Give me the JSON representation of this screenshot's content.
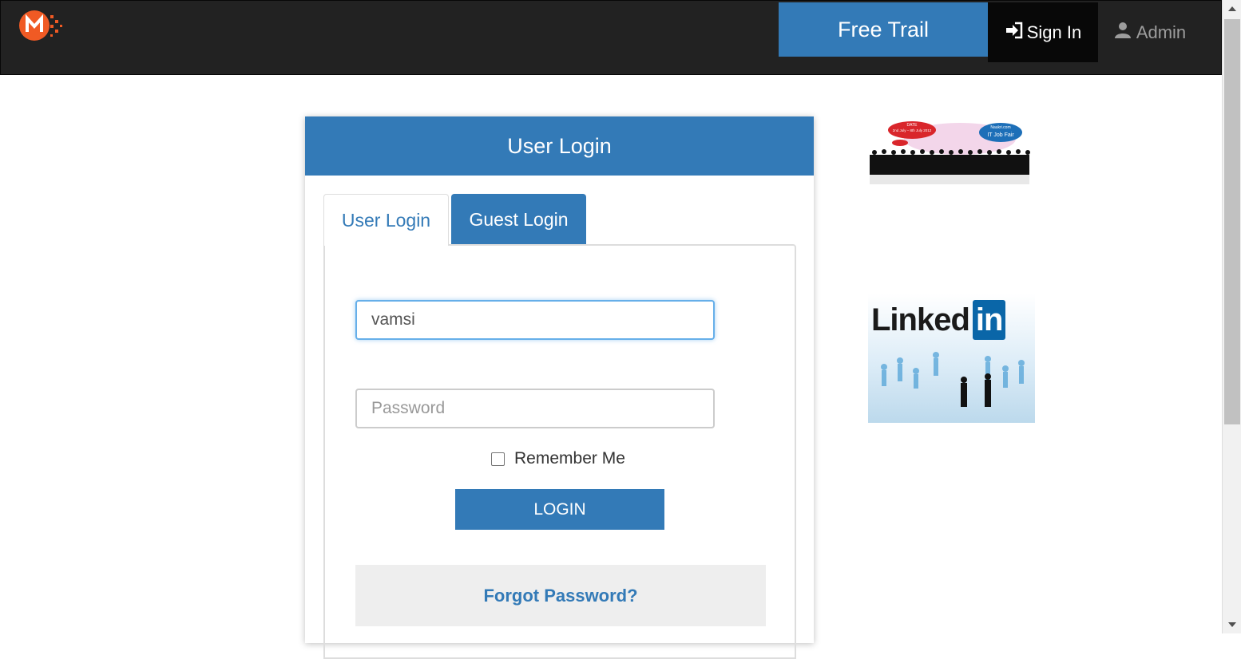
{
  "navbar": {
    "free_trail": "Free Trail",
    "sign_in": "Sign In",
    "admin": "Admin"
  },
  "panel": {
    "title": "User Login"
  },
  "tabs": {
    "user_login": "User Login",
    "guest_login": "Guest Login"
  },
  "form": {
    "username_value": "vamsi",
    "password_placeholder": "Password",
    "remember_label": "Remember Me",
    "login_button": "LOGIN",
    "forgot_link": "Forgot Password?"
  },
  "ads": {
    "job_fair_date_label": "DATE",
    "job_fair_date": "2nd July – 8th July 2012",
    "job_fair_site": "Naukri.com",
    "job_fair_title": "IT Job Fair",
    "linkedin_word": "Linked",
    "linkedin_in": "in"
  },
  "colors": {
    "brand_blue": "#337ab7",
    "navbar_bg": "#222222",
    "logo_orange": "#f05a24"
  }
}
